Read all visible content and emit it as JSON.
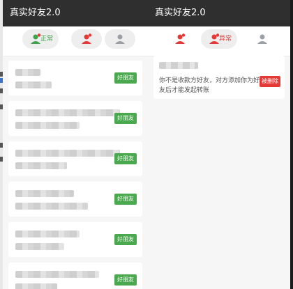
{
  "colors": {
    "accent_green": "#4aa94e",
    "accent_red": "#e53935",
    "titlebar": "#2f2f2f"
  },
  "left_panel": {
    "title": "真实好友2.0",
    "tabs": [
      {
        "label": "正常",
        "icon": "person-icon-green",
        "active": true
      },
      {
        "label": "",
        "icon": "person-icon-red",
        "active": false
      },
      {
        "label": "",
        "icon": "person-icon-gray",
        "active": false
      }
    ],
    "friend_button_label": "好朋友"
  },
  "right_panel": {
    "title": "真实好友2.0",
    "tabs": [
      {
        "label": "",
        "icon": "person-icon-red",
        "active": false
      },
      {
        "label": "异常",
        "icon": "person-icon-red",
        "active": true
      },
      {
        "label": "",
        "icon": "person-icon-gray",
        "active": false
      }
    ],
    "message": "你不是收款方好友，对方添加你为好友后才能发起转账",
    "delete_label": "被删除"
  }
}
